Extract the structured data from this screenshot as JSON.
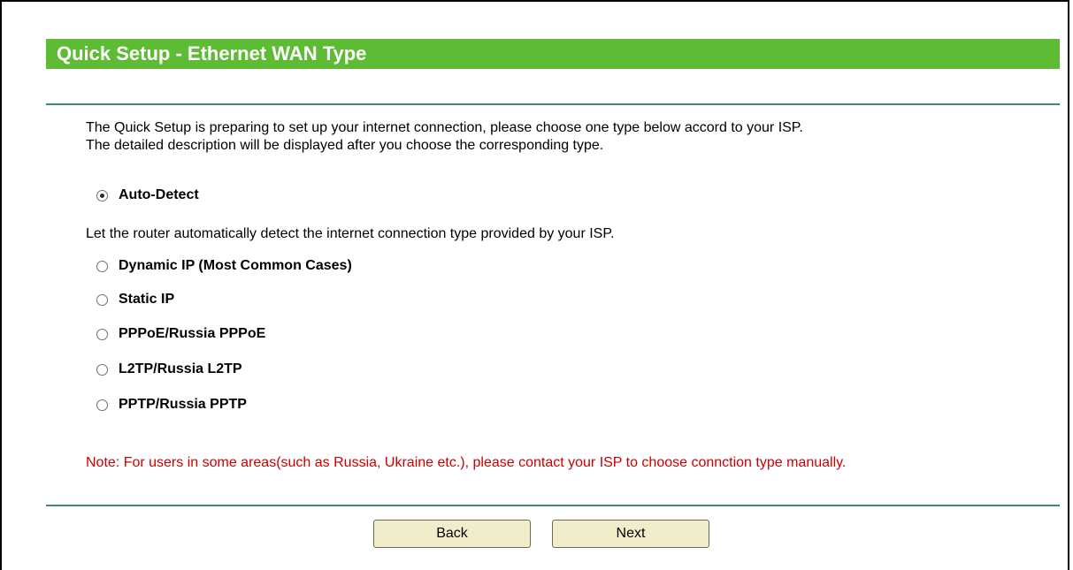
{
  "header": {
    "title": "Quick Setup - Ethernet WAN Type"
  },
  "intro": {
    "line1": "The Quick Setup is preparing to set up your internet connection, please choose one type below accord to your ISP.",
    "line2": "The detailed description will be displayed after you choose the corresponding type."
  },
  "options": [
    {
      "label": "Auto-Detect",
      "selected": true
    },
    {
      "label": "Dynamic IP (Most Common Cases)",
      "selected": false
    },
    {
      "label": "Static IP",
      "selected": false
    },
    {
      "label": "PPPoE/Russia PPPoE",
      "selected": false
    },
    {
      "label": "L2TP/Russia L2TP",
      "selected": false
    },
    {
      "label": "PPTP/Russia PPTP",
      "selected": false
    }
  ],
  "selected_description": "Let the router automatically detect the internet connection type provided by your ISP.",
  "note": "Note: For users in some areas(such as Russia, Ukraine etc.), please contact your ISP to choose connction type manually.",
  "buttons": {
    "back_label": "Back",
    "next_label": "Next"
  },
  "colors": {
    "title_bar": "#5dbb34",
    "rule": "#3f8a6a",
    "note_text": "#cc0000",
    "button_bg": "#f1ecc9"
  }
}
